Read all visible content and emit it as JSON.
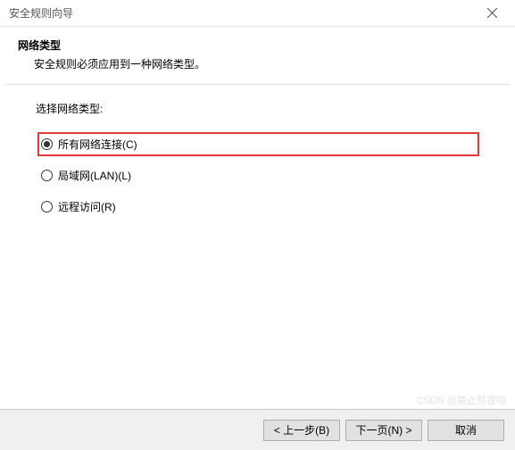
{
  "window": {
    "title": "安全规则向导"
  },
  "header": {
    "title": "网络类型",
    "description": "安全规则必须应用到一种网络类型。"
  },
  "content": {
    "section_label": "选择网络类型:",
    "options": [
      {
        "label": "所有网络连接(C)",
        "checked": true,
        "highlighted": true
      },
      {
        "label": "局域网(LAN)(L)",
        "checked": false,
        "highlighted": false
      },
      {
        "label": "远程访问(R)",
        "checked": false,
        "highlighted": false
      }
    ]
  },
  "footer": {
    "back": "< 上一步(B)",
    "next": "下一页(N) >",
    "cancel": "取消"
  },
  "watermark": "CSDN @禁止然夜啦"
}
